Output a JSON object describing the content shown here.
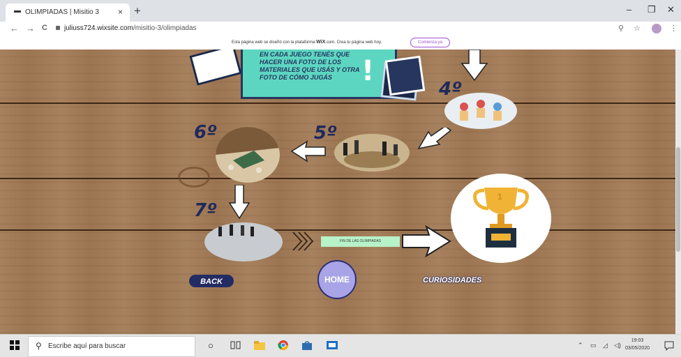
{
  "browser": {
    "tab_title": "OLIMPIADAS | Misitio 3",
    "tab_close": "×",
    "new_tab": "+",
    "minimize": "–",
    "maximize": "❐",
    "close": "✕",
    "back": "←",
    "forward": "→",
    "reload": "C",
    "url_domain": "juliuss724.wixsite.com",
    "url_path": "/misitio-3/olimpiadas",
    "zoom_icon": "⚲",
    "star_icon": "☆",
    "menu_icon": "⋮"
  },
  "wix_banner": {
    "text_before": "Esta página web se diseñó con la plataforma ",
    "brand": "WiX",
    "text_after": ".com. Crea tu página web hoy.",
    "button": "Comienza ya"
  },
  "content": {
    "card_text": "EN CADA JUEGO TENÉS QUE HACER UNA FOTO DE LOS MATERIALES QUE USÁS Y OTRA FOTO DE CÓMO JUGÁS",
    "card_exclamation": "!",
    "steps": [
      "4º",
      "5º",
      "6º",
      "7º"
    ],
    "finish_label": "FIN DE LAS OLIMPIADAS",
    "back_label": "BACK",
    "home_label": "HOME",
    "curiosities_label": "CURIOSIDADES",
    "trophy_number": "1"
  },
  "taskbar": {
    "search_placeholder": "Escribe aquí para buscar",
    "time": "19:03",
    "date": "03/05/2020"
  },
  "colors": {
    "wood": "#a27a55",
    "navy": "#232b63",
    "mint": "#5dd6c1",
    "home_purple": "#a8a4e7",
    "label_green": "#b7f2c9",
    "trophy_gold": "#f0b335",
    "trophy_bg": "#ffffff"
  }
}
